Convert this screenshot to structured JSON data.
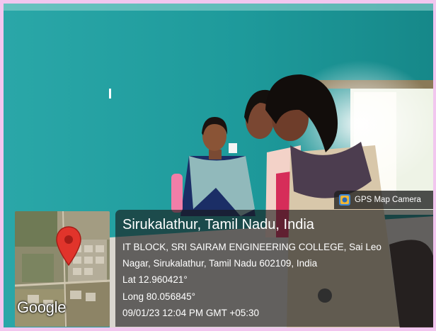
{
  "overlay": {
    "app_badge": {
      "icon": "gps-map-camera-icon",
      "label": "GPS Map Camera"
    },
    "map": {
      "logo": "Google",
      "pin_icon": "map-pin-icon"
    },
    "location": {
      "city": "Sirukalathur, Tamil Nadu, India",
      "address_line1": "IT BLOCK, SRI SAIRAM ENGINEERING COLLEGE, Sai Leo",
      "address_line2": "Nagar, Sirukalathur, Tamil Nadu 602109, India",
      "latitude": "Lat 12.960421°",
      "longitude": "Long 80.056845°",
      "timestamp": "09/01/23 12:04 PM GMT +05:30"
    }
  },
  "colors": {
    "wall": "#1f9a9a",
    "frame": "#f2c6ef",
    "pin": "#e1342b"
  }
}
